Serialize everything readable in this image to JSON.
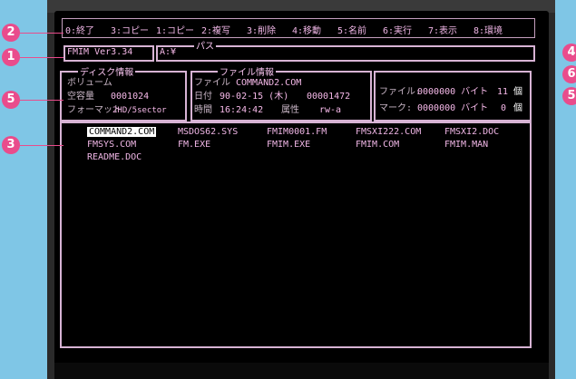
{
  "callouts": [
    "1",
    "2",
    "3",
    "4",
    "5",
    "6",
    "5"
  ],
  "menu": [
    {
      "label": "0:終了"
    },
    {
      "label": "3:コピー"
    },
    {
      "label": "1:コピー"
    },
    {
      "label": "2:複写"
    },
    {
      "label": "3:削除"
    },
    {
      "label": "4:移動"
    },
    {
      "label": "5:名前"
    },
    {
      "label": "6:実行"
    },
    {
      "label": "7:表示"
    },
    {
      "label": "8:環境"
    }
  ],
  "path_bar": {
    "title": "パス",
    "version": "FMIM Ver3.34",
    "path": "A:¥"
  },
  "disk_panel": {
    "title": "ディスク情報",
    "drive_label": "ボリューム",
    "free_label": "空容量",
    "free_value": "0001024",
    "sector_label": "フォーマット",
    "sector_value": "2HD/5sector"
  },
  "file_panel": {
    "title": "ファイル情報",
    "name_label": "ファイル",
    "name_value": "COMMAND2.COM",
    "date_label": "日付",
    "date_value": "90-02-15 (木)",
    "size_value": "00001472",
    "time_label": "時間",
    "time_value": "16:24:42",
    "attr_label": "属性",
    "attr_value": "rw-a"
  },
  "stats_panel": {
    "row1_label": "ファイル:",
    "row1_value": "0000000 バイト",
    "row1_count": "11",
    "row1_unit": "個",
    "row2_label": "マーク:",
    "row2_value": "0000000 バイト",
    "row2_count": "0",
    "row2_unit": "個"
  },
  "files": [
    "COMMAND2.COM",
    "MSDOS62.SYS",
    "FMIM0001.FM",
    "FMSXI222.COM",
    "FMSXI2.DOC",
    "FMSYS.COM",
    "FM.EXE",
    "FMIM.EXE",
    "FMIM.COM",
    "FMIM.MAN",
    "README.DOC"
  ]
}
